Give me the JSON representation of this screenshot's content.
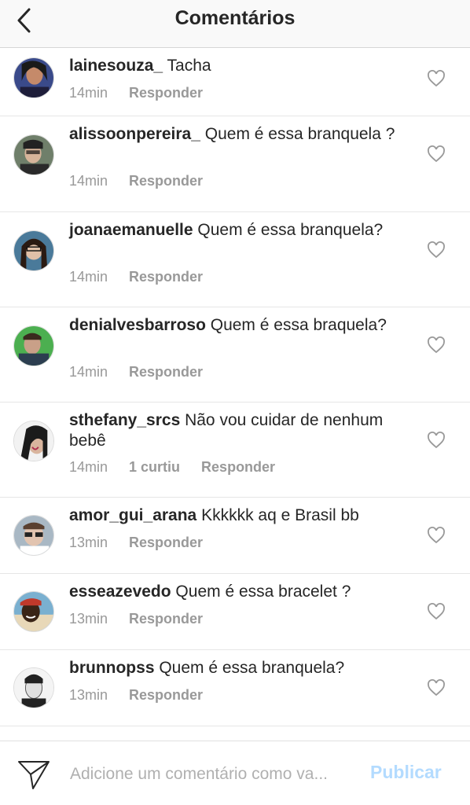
{
  "header": {
    "title": "Comentários"
  },
  "icons": {
    "back": "chevron-left-icon",
    "like": "heart-outline-icon",
    "send": "paper-plane-icon"
  },
  "comments": [
    {
      "user": "lainesouza_",
      "text": " Tacha",
      "time": "14min",
      "likes": "",
      "reply": "Responder"
    },
    {
      "user": "alissoonpereira_",
      "text": " Quem é essa branquela ?",
      "time": "14min",
      "likes": "",
      "reply": "Responder"
    },
    {
      "user": "joanaemanuelle",
      "text": " Quem é essa branquela?",
      "time": "14min",
      "likes": "",
      "reply": "Responder"
    },
    {
      "user": "denialvesbarroso",
      "text": " Quem é essa braquela?",
      "time": "14min",
      "likes": "",
      "reply": "Responder"
    },
    {
      "user": "sthefany_srcs",
      "text": " Não vou cuidar de nenhum bebê",
      "time": "14min",
      "likes": "1 curtiu",
      "reply": "Responder"
    },
    {
      "user": "amor_gui_arana",
      "text": " Kkkkkk aq e Brasil bb",
      "time": "13min",
      "likes": "",
      "reply": "Responder"
    },
    {
      "user": "esseazevedo",
      "text": " Quem é essa bracelet ?",
      "time": "13min",
      "likes": "",
      "reply": "Responder"
    },
    {
      "user": "brunnopss",
      "text": " Quem é essa branquela?",
      "time": "13min",
      "likes": "",
      "reply": "Responder"
    }
  ],
  "compose": {
    "placeholder": "Adicione um comentário como va...",
    "publish_label": "Publicar"
  }
}
